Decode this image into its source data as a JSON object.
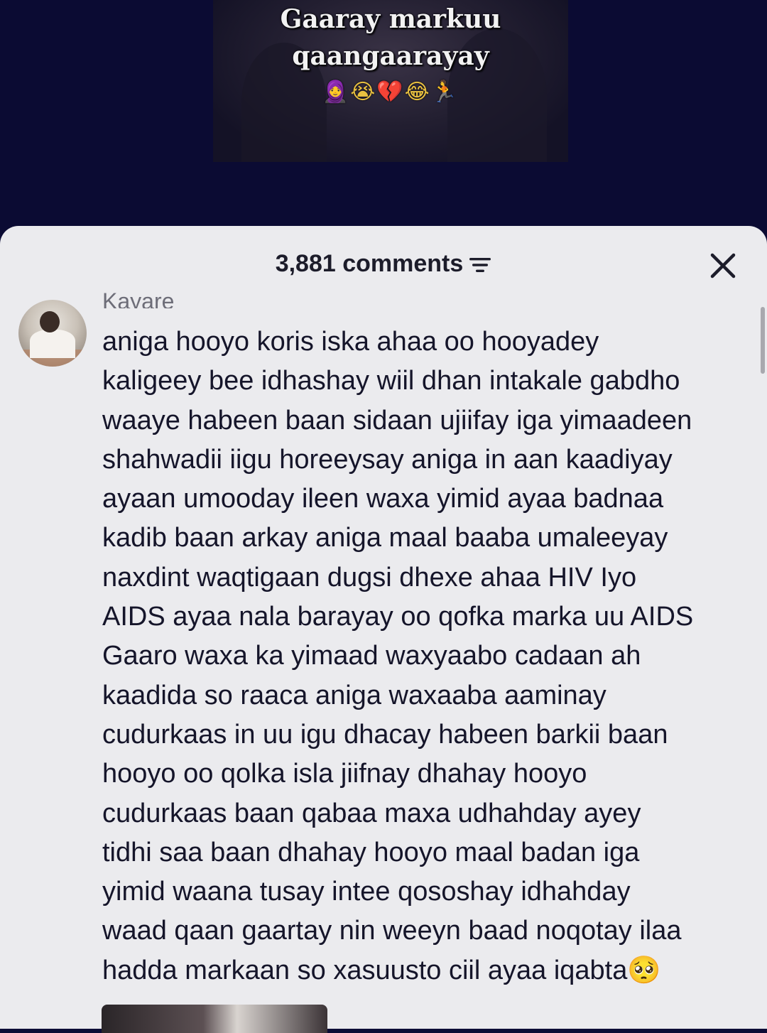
{
  "video": {
    "caption_line1": "Gaaray markuu",
    "caption_line2": "qaangaarayay",
    "caption_emojis": "🧕😭💔😂🏃"
  },
  "comments_sheet": {
    "count_label": "3,881 comments",
    "filter_icon": "filter-icon",
    "close_icon": "close-icon",
    "background": "#ebebee"
  },
  "comment": {
    "username": "Kayare",
    "lines": [
      "aniga hooyo koris iska ahaa oo hooyadey",
      "kaligeey bee idhashay wiil dhan intakale gabdho",
      "waaye habeen baan sidaan ujiifay iga yimaadeen",
      "shahwadii iigu horeeysay aniga in aan kaadiyay",
      "ayaan umooday ileen waxa yimid ayaa badnaa",
      "kadib baan arkay aniga maal baaba umaleeyay",
      "naxdint waqtigaan dugsi dhexe ahaa HIV Iyo",
      "AIDS ayaa nala barayay oo qofka marka uu AIDS",
      "Gaaro waxa ka yimaad waxyaabo cadaan ah",
      "kaadida so raaca aniga waxaaba aaminay",
      "cudurkaas in uu igu dhacay habeen barkii baan",
      "hooyo oo qolka isla jiifnay dhahay hooyo",
      "cudurkaas baan qabaa maxa udhahday ayey",
      "tidhi saa baan dhahay hooyo maal badan iga",
      "yimid waana tusay intee qososhay idhahday",
      "waad qaan gaartay nin weeyn baad noqotay ilaa",
      "hadda markaan so xasuusto ciil ayaa iqabta🥺"
    ]
  }
}
